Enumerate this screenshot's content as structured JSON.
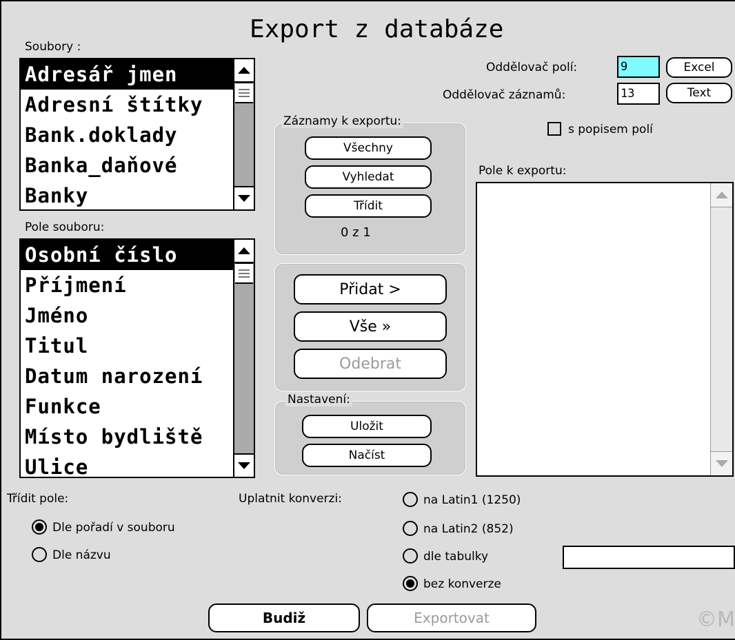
{
  "window": {
    "title": "Export z databáze",
    "copyright": "©M"
  },
  "files": {
    "label": "Soubory :",
    "items": [
      "Adresář jmen",
      "Adresní štítky",
      "Bank.doklady",
      "Banka_daňové",
      "Banky"
    ],
    "selected_index": 0
  },
  "fields": {
    "label": "Pole souboru:",
    "items": [
      "Osobní číslo",
      "Příjmení",
      "Jméno",
      "Titul",
      "Datum narození",
      "Funkce",
      "Místo bydliště",
      "Ulice"
    ],
    "selected_index": 0
  },
  "records": {
    "group_title": "Záznamy k exportu:",
    "all_label": "Všechny",
    "find_label": "Vyhledat",
    "sort_label": "Třídit",
    "count_text": "0 z 1"
  },
  "actions": {
    "add_label": "Přidat >",
    "all_label": "Vše »",
    "remove_label": "Odebrat"
  },
  "settings": {
    "group_title": "Nastavení:",
    "save_label": "Uložit",
    "load_label": "Načíst"
  },
  "separators": {
    "field_label": "Oddělovač polí:",
    "field_value": "9",
    "record_label": "Oddělovač záznamů:",
    "record_value": "13",
    "excel_label": "Excel",
    "text_label": "Text",
    "describe_label": "s popisem polí",
    "describe_checked": false
  },
  "export_fields": {
    "label": "Pole k exportu:"
  },
  "sort_fields": {
    "label": "Třídit pole:",
    "options": [
      "Dle pořadí v souboru",
      "Dle názvu"
    ],
    "selected_index": 0
  },
  "conversion": {
    "label": "Uplatnit konverzi:",
    "options": [
      "na Latin1 (1250)",
      "na Latin2 (852)",
      "dle tabulky",
      "bez konverze"
    ],
    "selected_index": 3,
    "table_value": ""
  },
  "footer": {
    "ok_label": "Budiž",
    "export_label": "Exportovat"
  }
}
